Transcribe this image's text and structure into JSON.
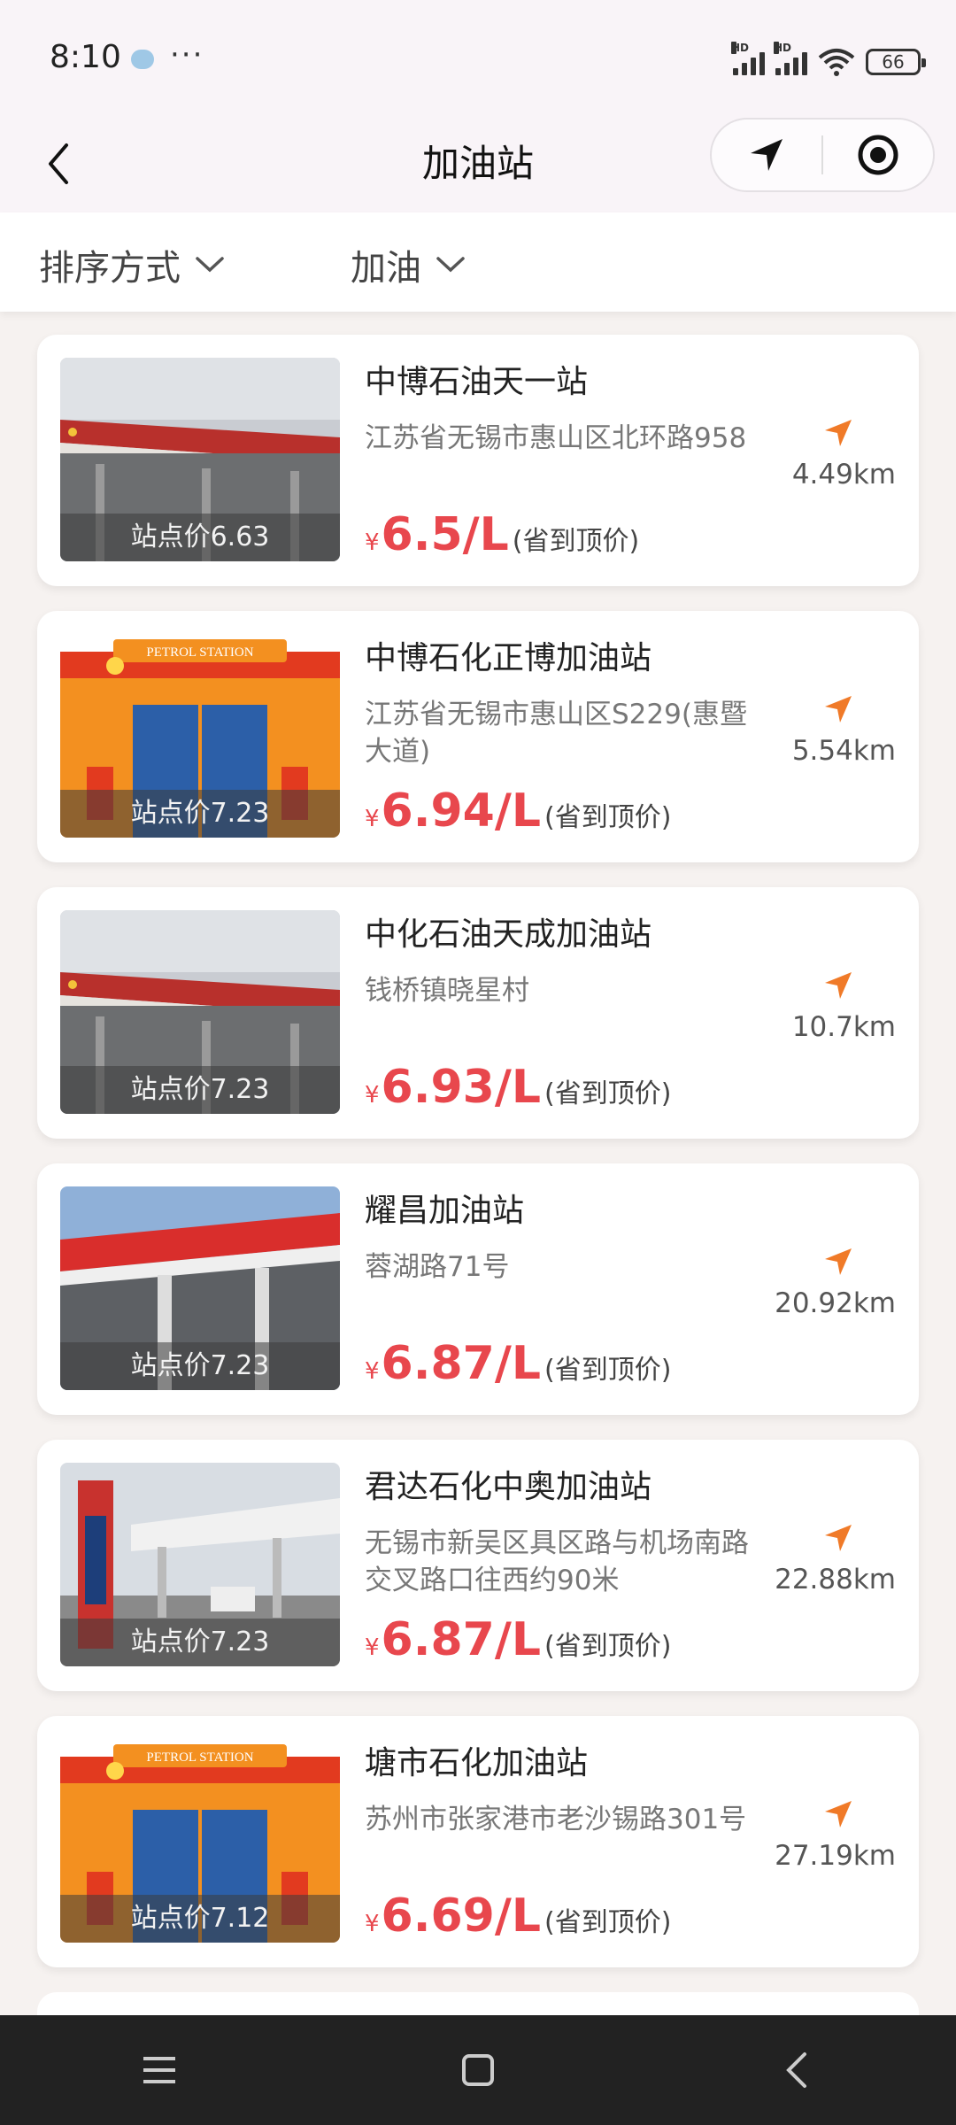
{
  "status_bar": {
    "time": "8:10",
    "dots": "···",
    "signal1_label": "HD",
    "signal2_label": "HD",
    "battery": "66"
  },
  "header": {
    "title": "加油站",
    "back_icon": "chevron-left-icon",
    "location_icon": "navigation-arrow-icon",
    "target_icon": "record-target-icon"
  },
  "filters": {
    "sort_label": "排序方式",
    "fuel_label": "加油"
  },
  "stations": [
    {
      "name": "中博石油天一站",
      "address": "江苏省无锡市惠山区北环路958",
      "station_price": "站点价6.63",
      "price": "6.5/L",
      "price_note": "(省到顶价)",
      "distance": "4.49km",
      "thumb": "photo"
    },
    {
      "name": "中博石化正博加油站",
      "address": "江苏省无锡市惠山区S229(惠暨大道)",
      "station_price": "站点价7.23",
      "price": "6.94/L",
      "price_note": "(省到顶价)",
      "distance": "5.54km",
      "thumb": "illustration"
    },
    {
      "name": "中化石油天成加油站",
      "address": "钱桥镇晓星村",
      "station_price": "站点价7.23",
      "price": "6.93/L",
      "price_note": "(省到顶价)",
      "distance": "10.7km",
      "thumb": "photo"
    },
    {
      "name": "耀昌加油站",
      "address": "蓉湖路71号",
      "station_price": "站点价7.23",
      "price": "6.87/L",
      "price_note": "(省到顶价)",
      "distance": "20.92km",
      "thumb": "photo2"
    },
    {
      "name": "君达石化中奥加油站",
      "address": "无锡市新吴区具区路与机场南路交叉路口往西约90米",
      "station_price": "站点价7.23",
      "price": "6.87/L",
      "price_note": "(省到顶价)",
      "distance": "22.88km",
      "thumb": "photo3"
    },
    {
      "name": "塘市石化加油站",
      "address": "苏州市张家港市老沙锡路301号",
      "station_price": "站点价7.12",
      "price": "6.69/L",
      "price_note": "(省到顶价)",
      "distance": "27.19km",
      "thumb": "illustration"
    }
  ],
  "currency_symbol": "¥",
  "illustration_sign": "PETROL STATION",
  "colors": {
    "price_red": "#e8474d",
    "distance_orange": "#f07a28",
    "background": "#f6f2f0"
  }
}
